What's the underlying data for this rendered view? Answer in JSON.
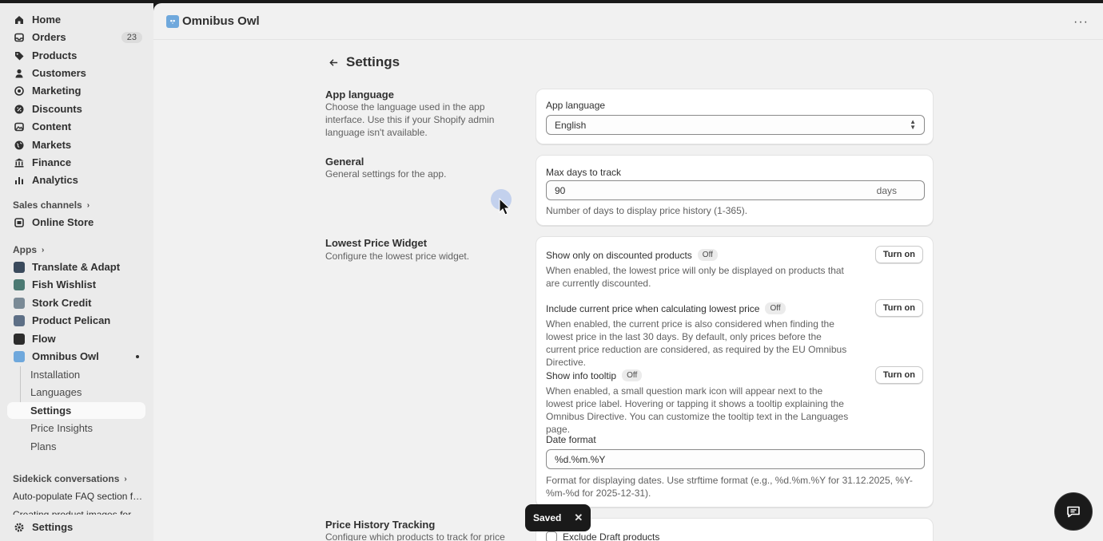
{
  "sidebar": {
    "nav": [
      {
        "label": "Home",
        "icon": "home-icon"
      },
      {
        "label": "Orders",
        "icon": "orders-icon",
        "badge": "23"
      },
      {
        "label": "Products",
        "icon": "tag-icon"
      },
      {
        "label": "Customers",
        "icon": "person-icon"
      },
      {
        "label": "Marketing",
        "icon": "target-icon"
      },
      {
        "label": "Discounts",
        "icon": "discount-icon"
      },
      {
        "label": "Content",
        "icon": "content-icon"
      },
      {
        "label": "Markets",
        "icon": "globe-icon"
      },
      {
        "label": "Finance",
        "icon": "bank-icon"
      },
      {
        "label": "Analytics",
        "icon": "chart-icon"
      }
    ],
    "sales_channels_heading": "Sales channels",
    "sales_channels": [
      {
        "label": "Online Store",
        "icon": "store-icon"
      }
    ],
    "apps_heading": "Apps",
    "apps": [
      {
        "label": "Translate & Adapt",
        "color": "#3a4a5c"
      },
      {
        "label": "Fish Wishlist",
        "color": "#4c7a73"
      },
      {
        "label": "Stork Credit",
        "color": "#7a8a96"
      },
      {
        "label": "Product Pelican",
        "color": "#5d6f86"
      },
      {
        "label": "Flow",
        "color": "#2c2c2c"
      },
      {
        "label": "Omnibus Owl",
        "color": "#6fa8dc"
      }
    ],
    "app_subitems": [
      "Installation",
      "Languages",
      "Settings",
      "Price Insights",
      "Plans"
    ],
    "sidekick_heading": "Sidekick conversations",
    "sidekick_items": [
      "Auto-populate FAQ section fro...",
      "Creating product images for p..."
    ],
    "footer_settings": "Settings"
  },
  "header": {
    "app_title": "Omnibus Owl"
  },
  "page": {
    "title": "Settings",
    "sections": {
      "app_language": {
        "title": "App language",
        "desc": "Choose the language used in the app interface. Use this if your Shopify admin language isn't available.",
        "field_label": "App language",
        "value": "English"
      },
      "general": {
        "title": "General",
        "desc": "General settings for the app.",
        "field_label": "Max days to track",
        "value": "90",
        "suffix": "days",
        "help": "Number of days to display price history (1-365)."
      },
      "widget": {
        "title": "Lowest Price Widget",
        "desc": "Configure the lowest price widget.",
        "options": [
          {
            "title": "Show only on discounted products",
            "status": "Off",
            "button": "Turn on",
            "desc": "When enabled, the lowest price will only be displayed on products that are currently discounted."
          },
          {
            "title": "Include current price when calculating lowest price",
            "status": "Off",
            "button": "Turn on",
            "desc": "When enabled, the current price is also considered when finding the lowest price in the last 30 days. By default, only prices before the current price reduction are considered, as required by the EU Omnibus Directive."
          },
          {
            "title": "Show info tooltip",
            "status": "Off",
            "button": "Turn on",
            "desc": "When enabled, a small question mark icon will appear next to the lowest price label. Hovering or tapping it shows a tooltip explaining the Omnibus Directive. You can customize the tooltip text in the Languages page."
          }
        ],
        "date_label": "Date format",
        "date_value": "%d.%m.%Y",
        "date_help": "Format for displaying dates. Use strftime format (e.g., %d.%m.%Y for 31.12.2025, %Y-%m-%d for 2025-12-31)."
      },
      "tracking": {
        "title": "Price History Tracking",
        "desc": "Configure which products to track for price",
        "checkbox": "Exclude Draft products"
      }
    }
  },
  "toast": {
    "text": "Saved"
  }
}
